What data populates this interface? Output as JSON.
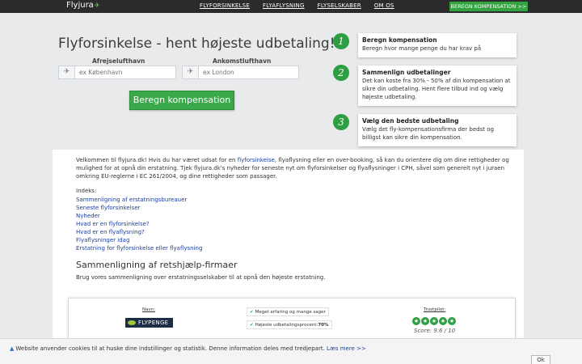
{
  "nav": {
    "logo": "Flyjura",
    "links": [
      "FLYFORSINKELSE",
      "FLYAFLYSNING",
      "FLYSELSKABER",
      "OM OS"
    ],
    "cta": "BEREGN KOMPENSATION >>"
  },
  "hero": {
    "title": "Flyforsinkelse - hent højeste udbetaling!",
    "departure_label": "Afrejselufthavn",
    "departure_placeholder": "ex København",
    "arrival_label": "Ankomstlufthavn",
    "arrival_placeholder": "ex London",
    "button": "Beregn kompensation"
  },
  "steps": [
    {
      "num": "1",
      "title": "Beregn kompensation",
      "text": "Beregn hvor mange penge du har krav på"
    },
    {
      "num": "2",
      "title": "Sammenlign udbetalinger",
      "text": "Det kan koste fra 30% - 50% af din kompensation at sikre din udbetaling. Hent flere tilbud ind og vælg højeste udbetaling."
    },
    {
      "num": "3",
      "title": "Vælg den bedste udbetaling",
      "text": "Vælg det fly-kompensationsfirma der bedst og billigst kan sikre din kompensation."
    }
  ],
  "intro": {
    "p1_before": "Velkommen til flyjura.dk! Hvis du har været udsat for en ",
    "p1_link": "flyforsinkelse",
    "p1_after": ", flyaflysning eller en over-booking, så kan du orientere dig om dine rettigheder og mulighed for at opnå din erstatning. Tjek flyjura.dk's nyheder for seneste nyt om flyforsinkelser og flyaflysninger i CPH, såvel som generelt nyt i juraen omkring EU-reglerne i EC 261/2004, og dine rettigheder som passager."
  },
  "index": {
    "title": "Indeks:",
    "links": [
      "Sammenligning af erstatningsbureauer",
      "Seneste flyforsinkelser",
      "Nyheder",
      "Hvad er en flyforsinkelse?",
      "Hvad er en flyaflysning?",
      "Flyaflysninger idag",
      "Erstatning for flyforsinkelse eller flyaflysning"
    ]
  },
  "comparison": {
    "title": "Sammenligning af retshjælp-firmaer",
    "subtitle": "Brug vores sammenligning over erstatningsselskaber til at opnå den højeste erstatning.",
    "col_name": "Navn:",
    "col_trust": "Trustpilot:",
    "company": "FLYPENGE",
    "features": [
      "Meget erfaring og mange sager",
      "Højeste udbetalingsprocent:"
    ],
    "payout_pct": "70%",
    "stars": 5,
    "score": "Score: 9.6 / 10"
  },
  "cookie": {
    "text": "Website anvender cookies til at huske dine indstillinger og statistik. Denne information deles med tredjepart.",
    "link": "Læs mere >>",
    "ok": "Ok"
  },
  "colors": {
    "green": "#39a94a",
    "nav": "#2b2b2b",
    "link": "#1a3fa0"
  }
}
